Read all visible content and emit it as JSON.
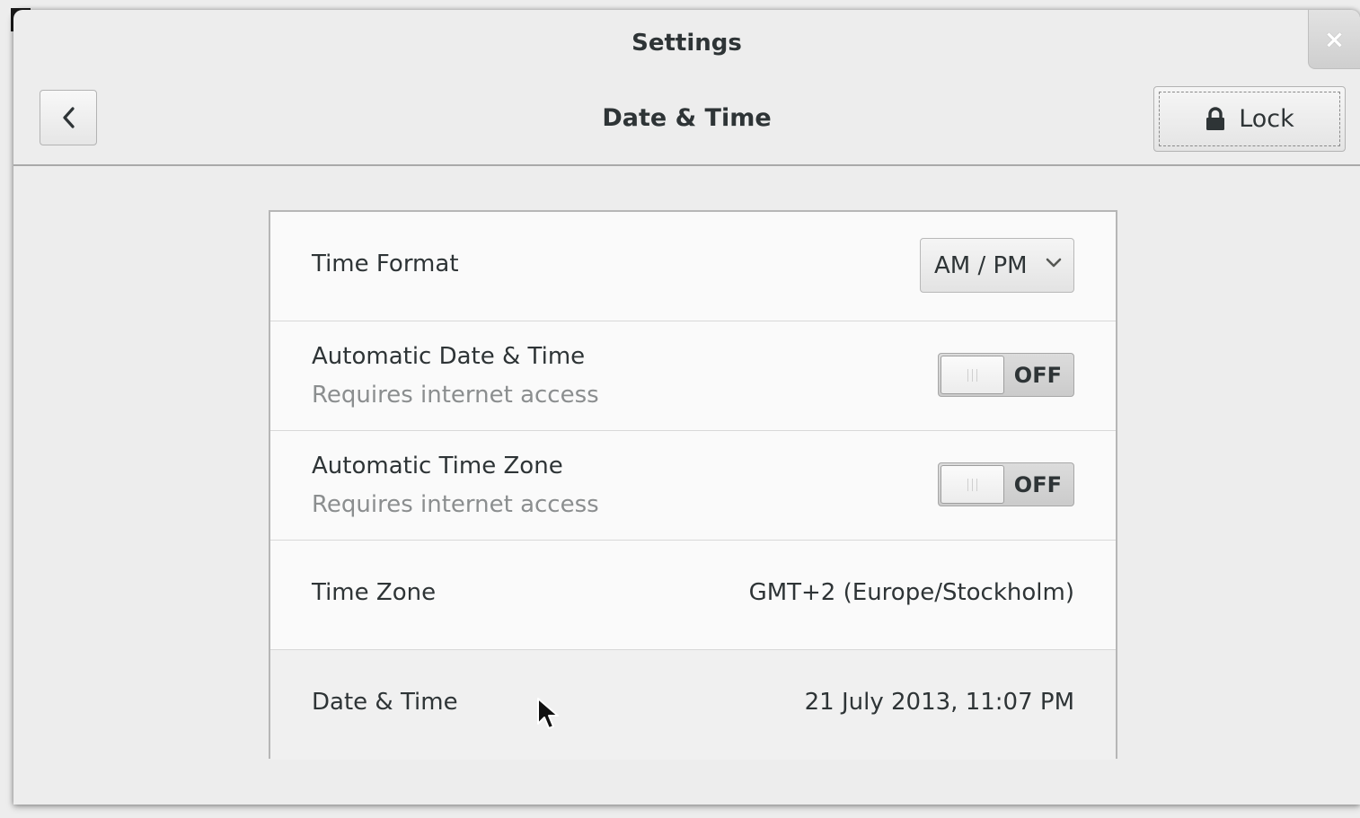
{
  "window": {
    "title": "Settings",
    "close_glyph": "×"
  },
  "header": {
    "back_icon": "chevron-left-icon",
    "title": "Date & Time",
    "lock_icon": "lock-icon",
    "lock_label": "Lock"
  },
  "rows": {
    "time_format": {
      "label": "Time Format",
      "value": "AM / PM"
    },
    "auto_datetime": {
      "label": "Automatic Date & Time",
      "sublabel": "Requires internet access",
      "state": "OFF"
    },
    "auto_timezone": {
      "label": "Automatic Time Zone",
      "sublabel": "Requires internet access",
      "state": "OFF"
    },
    "time_zone": {
      "label": "Time Zone",
      "value": "GMT+2 (Europe/Stockholm)"
    },
    "date_time": {
      "label": "Date & Time",
      "value": "21 July 2013, 11:07 PM"
    }
  },
  "colors": {
    "text": "#2e3436",
    "secondary_text": "#8b8e8f",
    "background": "#ededed",
    "panel": "#fafafa"
  }
}
